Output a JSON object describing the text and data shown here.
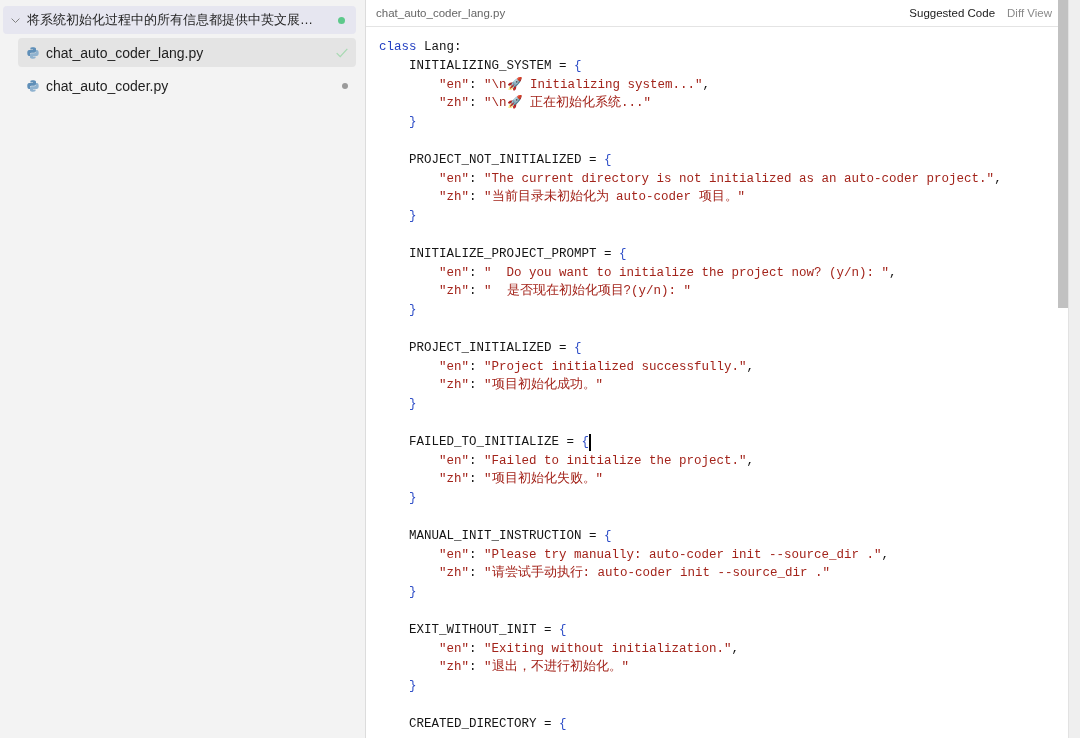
{
  "sidebar": {
    "group": {
      "title": "将系统初始化过程中的所有信息都提供中英文展…",
      "expanded": true,
      "active": true,
      "files": [
        {
          "name": "chat_auto_coder_lang.py",
          "selected": true,
          "accepted": true
        },
        {
          "name": "chat_auto_coder.py",
          "selected": false,
          "accepted": false
        }
      ]
    }
  },
  "editor": {
    "file_name": "chat_auto_coder_lang.py",
    "tabs": [
      {
        "label": "Suggested Code",
        "selected": true
      },
      {
        "label": "Diff View",
        "selected": false
      }
    ],
    "code": {
      "tokens": [
        {
          "kind": "keyword",
          "text": "class"
        },
        {
          "kind": "plain",
          "text": " Lang:"
        }
      ],
      "children": [
        {
          "caret": false,
          "tokens": [
            {
              "kind": "plain",
              "text": "INITIALIZING_SYSTEM = "
            },
            {
              "kind": "brace",
              "text": "{"
            }
          ],
          "children": [
            {
              "tokens": [
                {
                  "kind": "string",
                  "text": "\"en\""
                },
                {
                  "kind": "plain",
                  "text": ": "
                },
                {
                  "kind": "string",
                  "text": "\"\\n🚀 Initializing system...\""
                },
                {
                  "kind": "plain",
                  "text": ","
                }
              ]
            },
            {
              "tokens": [
                {
                  "kind": "string",
                  "text": "\"zh\""
                },
                {
                  "kind": "plain",
                  "text": ": "
                },
                {
                  "kind": "string",
                  "text": "\"\\n🚀 正在初始化系统...\""
                }
              ]
            }
          ],
          "end": [
            {
              "kind": "brace",
              "text": "}"
            }
          ]
        },
        {
          "caret": false,
          "tokens": [
            {
              "kind": "plain",
              "text": "PROJECT_NOT_INITIALIZED = "
            },
            {
              "kind": "brace",
              "text": "{"
            }
          ],
          "children": [
            {
              "tokens": [
                {
                  "kind": "string",
                  "text": "\"en\""
                },
                {
                  "kind": "plain",
                  "text": ": "
                },
                {
                  "kind": "string",
                  "text": "\"The current directory is not initialized as an auto-coder project.\""
                },
                {
                  "kind": "plain",
                  "text": ","
                }
              ]
            },
            {
              "tokens": [
                {
                  "kind": "string",
                  "text": "\"zh\""
                },
                {
                  "kind": "plain",
                  "text": ": "
                },
                {
                  "kind": "string",
                  "text": "\"当前目录未初始化为 auto-coder 项目。\""
                }
              ]
            }
          ],
          "end": [
            {
              "kind": "brace",
              "text": "}"
            }
          ]
        },
        {
          "caret": false,
          "tokens": [
            {
              "kind": "plain",
              "text": "INITIALIZE_PROJECT_PROMPT = "
            },
            {
              "kind": "brace",
              "text": "{"
            }
          ],
          "children": [
            {
              "tokens": [
                {
                  "kind": "string",
                  "text": "\"en\""
                },
                {
                  "kind": "plain",
                  "text": ": "
                },
                {
                  "kind": "string",
                  "text": "\"  Do you want to initialize the project now? (y/n): \""
                },
                {
                  "kind": "plain",
                  "text": ","
                }
              ]
            },
            {
              "tokens": [
                {
                  "kind": "string",
                  "text": "\"zh\""
                },
                {
                  "kind": "plain",
                  "text": ": "
                },
                {
                  "kind": "string",
                  "text": "\"  是否现在初始化项目?(y/n): \""
                }
              ]
            }
          ],
          "end": [
            {
              "kind": "brace",
              "text": "}"
            }
          ]
        },
        {
          "caret": false,
          "tokens": [
            {
              "kind": "plain",
              "text": "PROJECT_INITIALIZED = "
            },
            {
              "kind": "brace",
              "text": "{"
            }
          ],
          "children": [
            {
              "tokens": [
                {
                  "kind": "string",
                  "text": "\"en\""
                },
                {
                  "kind": "plain",
                  "text": ": "
                },
                {
                  "kind": "string",
                  "text": "\"Project initialized successfully.\""
                },
                {
                  "kind": "plain",
                  "text": ","
                }
              ]
            },
            {
              "tokens": [
                {
                  "kind": "string",
                  "text": "\"zh\""
                },
                {
                  "kind": "plain",
                  "text": ": "
                },
                {
                  "kind": "string",
                  "text": "\"项目初始化成功。\""
                }
              ]
            }
          ],
          "end": [
            {
              "kind": "brace",
              "text": "}"
            }
          ]
        },
        {
          "caret": true,
          "tokens": [
            {
              "kind": "plain",
              "text": "FAILED_TO_INITIALIZE = "
            },
            {
              "kind": "brace",
              "text": "{"
            }
          ],
          "children": [
            {
              "tokens": [
                {
                  "kind": "string",
                  "text": "\"en\""
                },
                {
                  "kind": "plain",
                  "text": ": "
                },
                {
                  "kind": "string",
                  "text": "\"Failed to initialize the project.\""
                },
                {
                  "kind": "plain",
                  "text": ","
                }
              ]
            },
            {
              "tokens": [
                {
                  "kind": "string",
                  "text": "\"zh\""
                },
                {
                  "kind": "plain",
                  "text": ": "
                },
                {
                  "kind": "string",
                  "text": "\"项目初始化失败。\""
                }
              ]
            }
          ],
          "end": [
            {
              "kind": "brace",
              "text": "}"
            }
          ]
        },
        {
          "caret": false,
          "tokens": [
            {
              "kind": "plain",
              "text": "MANUAL_INIT_INSTRUCTION = "
            },
            {
              "kind": "brace",
              "text": "{"
            }
          ],
          "children": [
            {
              "tokens": [
                {
                  "kind": "string",
                  "text": "\"en\""
                },
                {
                  "kind": "plain",
                  "text": ": "
                },
                {
                  "kind": "string",
                  "text": "\"Please try manually: auto-coder init --source_dir .\""
                },
                {
                  "kind": "plain",
                  "text": ","
                }
              ]
            },
            {
              "tokens": [
                {
                  "kind": "string",
                  "text": "\"zh\""
                },
                {
                  "kind": "plain",
                  "text": ": "
                },
                {
                  "kind": "string",
                  "text": "\"请尝试手动执行: auto-coder init --source_dir .\""
                }
              ]
            }
          ],
          "end": [
            {
              "kind": "brace",
              "text": "}"
            }
          ]
        },
        {
          "caret": false,
          "tokens": [
            {
              "kind": "plain",
              "text": "EXIT_WITHOUT_INIT = "
            },
            {
              "kind": "brace",
              "text": "{"
            }
          ],
          "children": [
            {
              "tokens": [
                {
                  "kind": "string",
                  "text": "\"en\""
                },
                {
                  "kind": "plain",
                  "text": ": "
                },
                {
                  "kind": "string",
                  "text": "\"Exiting without initialization.\""
                },
                {
                  "kind": "plain",
                  "text": ","
                }
              ]
            },
            {
              "tokens": [
                {
                  "kind": "string",
                  "text": "\"zh\""
                },
                {
                  "kind": "plain",
                  "text": ": "
                },
                {
                  "kind": "string",
                  "text": "\"退出，不进行初始化。\""
                }
              ]
            }
          ],
          "end": [
            {
              "kind": "brace",
              "text": "}"
            }
          ]
        },
        {
          "caret": false,
          "tokens": [
            {
              "kind": "plain",
              "text": "CREATED_DIRECTORY = "
            },
            {
              "kind": "brace",
              "text": "{"
            }
          ]
        }
      ]
    }
  }
}
